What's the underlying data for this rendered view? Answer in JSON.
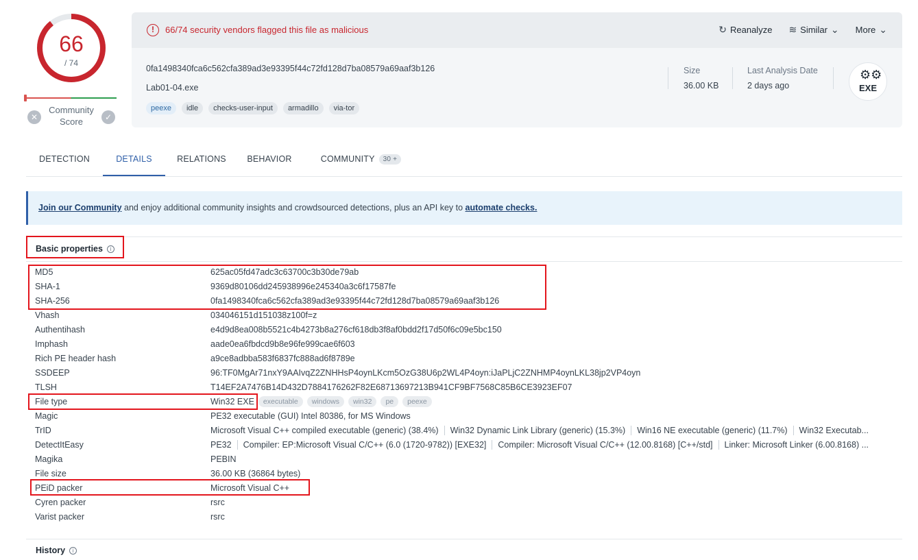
{
  "score": {
    "detections": "66",
    "total": "/ 74",
    "community_label": "Community Score"
  },
  "alert": {
    "text": "66/74 security vendors flagged this file as malicious"
  },
  "actions": {
    "reanalyze": "Reanalyze",
    "similar": "Similar",
    "more": "More"
  },
  "file": {
    "hash": "0fa1498340fca6c562cfa389ad3e93395f44c72fd128d7ba08579a69aaf3b126",
    "name": "Lab01-04.exe",
    "tags": [
      "peexe",
      "idle",
      "checks-user-input",
      "armadillo",
      "via-tor"
    ],
    "size_label": "Size",
    "size_value": "36.00 KB",
    "last_analysis_label": "Last Analysis Date",
    "last_analysis_value": "2 days ago",
    "type_badge": "EXE"
  },
  "tabs": [
    {
      "label": "DETECTION"
    },
    {
      "label": "DETAILS"
    },
    {
      "label": "RELATIONS"
    },
    {
      "label": "BEHAVIOR"
    },
    {
      "label": "COMMUNITY",
      "count": "30 +"
    }
  ],
  "active_tab": "DETAILS",
  "banner": {
    "link1": "Join our Community",
    "middle": " and enjoy additional community insights and crowdsourced detections, plus an API key to ",
    "link2": "automate checks."
  },
  "basic_properties": {
    "title": "Basic properties",
    "rows": [
      {
        "key": "MD5",
        "value": "625ac05fd47adc3c63700c3b30de79ab"
      },
      {
        "key": "SHA-1",
        "value": "9369d80106dd245938996e245340a3c6f17587fe"
      },
      {
        "key": "SHA-256",
        "value": "0fa1498340fca6c562cfa389ad3e93395f44c72fd128d7ba08579a69aaf3b126"
      },
      {
        "key": "Vhash",
        "value": "034046151d151038z100f=z"
      },
      {
        "key": "Authentihash",
        "value": "e4d9d8ea008b5521c4b4273b8a276cf618db3f8af0bdd2f17d50f6c09e5bc150"
      },
      {
        "key": "Imphash",
        "value": "aade0ea6fbdcd9b8e96fe999cae6f603"
      },
      {
        "key": "Rich PE header hash",
        "value": "a9ce8adbba583f6837fc888ad6f8789e"
      },
      {
        "key": "SSDEEP",
        "value": "96:TF0MgAr71nxY9AAIvqZ2ZNHHsP4oynLKcm5OzG38U6p2WL4P4oyn:iJaPLjC2ZNHMP4oynLKL38jp2VP4oyn"
      },
      {
        "key": "TLSH",
        "value": "T14EF2A7476B14D432D7884176262F82E68713697213B941CF9BF7568C85B6CE3923EF07"
      },
      {
        "key": "File type",
        "value": "Win32 EXE",
        "tags": [
          "executable",
          "windows",
          "win32",
          "pe",
          "peexe"
        ]
      },
      {
        "key": "Magic",
        "value": "PE32 executable (GUI) Intel 80386, for MS Windows"
      },
      {
        "key": "TrID",
        "segments": [
          "Microsoft Visual C++ compiled executable (generic) (38.4%)",
          "Win32 Dynamic Link Library (generic) (15.3%)",
          "Win16 NE executable (generic) (11.7%)",
          "Win32 Executab..."
        ]
      },
      {
        "key": "DetectItEasy",
        "segments": [
          "PE32",
          "Compiler: EP:Microsoft Visual C/C++ (6.0 (1720-9782)) [EXE32]",
          "Compiler: Microsoft Visual C/C++ (12.00.8168) [C++/std]",
          "Linker: Microsoft Linker (6.00.8168) ..."
        ]
      },
      {
        "key": "Magika",
        "value": "PEBIN"
      },
      {
        "key": "File size",
        "value": "36.00 KB (36864 bytes)"
      },
      {
        "key": "PEiD packer",
        "value": "Microsoft Visual C++"
      },
      {
        "key": "Cyren packer",
        "value": "rsrc"
      },
      {
        "key": "Varist packer",
        "value": "rsrc"
      }
    ]
  },
  "history": {
    "title": "History"
  },
  "colors": {
    "malicious": "#c8262e",
    "accent": "#2f5fa8",
    "highlight": "#e3151c"
  }
}
